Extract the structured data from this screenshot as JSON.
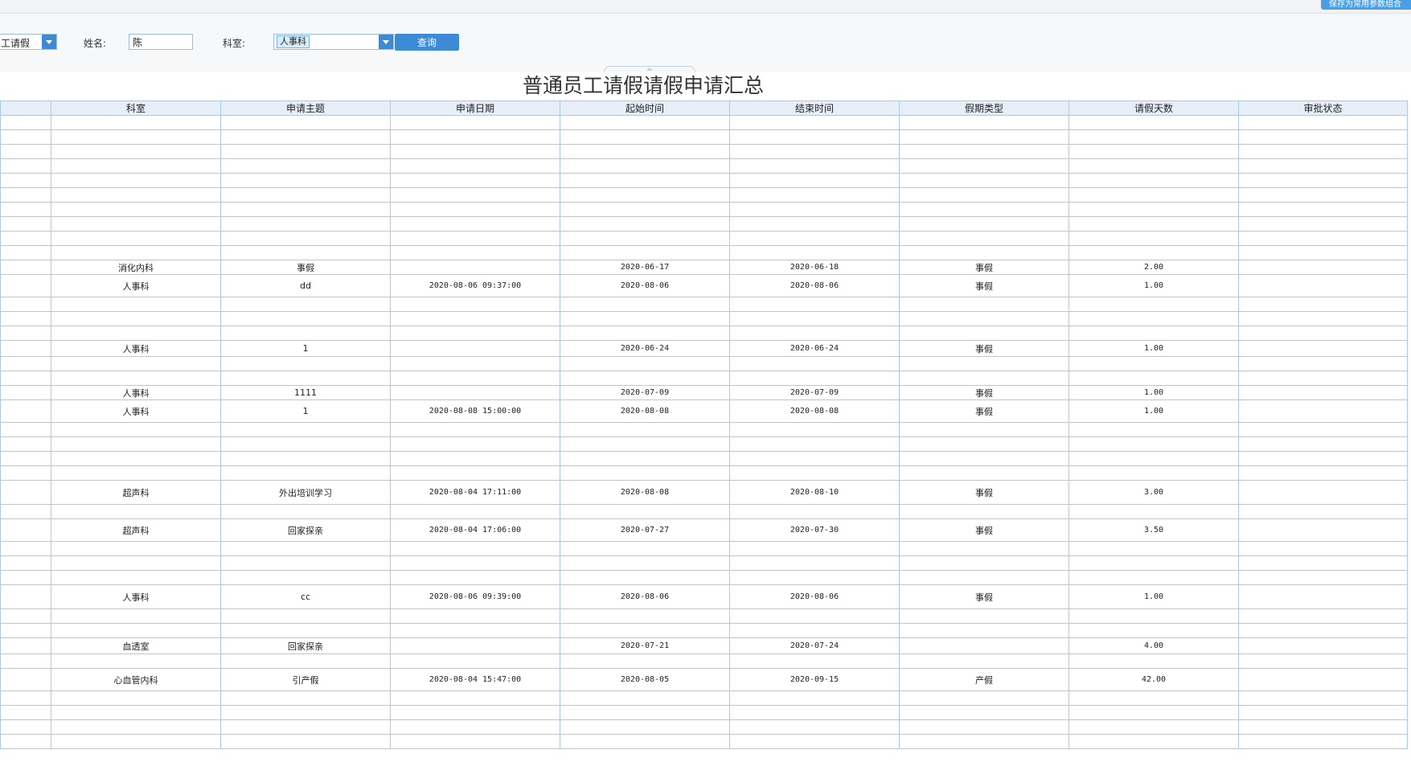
{
  "toolbar": {
    "save_label": "保存为常用参数组合"
  },
  "filters": {
    "type_value": "工请假",
    "name_label": "姓名:",
    "name_value": "陈",
    "dept_label": "科室:",
    "dept_tag": "人事科",
    "query_label": "查询"
  },
  "report": {
    "title": "普通员工请假请假申请汇总"
  },
  "table": {
    "headers": [
      "",
      "科室",
      "申请主题",
      "申请日期",
      "起始时间",
      "结束时间",
      "假期类型",
      "请假天数",
      "审批状态"
    ],
    "rows": [
      {
        "h": 18,
        "cells": [
          "",
          "",
          "",
          "",
          "",
          "",
          "",
          "",
          ""
        ]
      },
      {
        "h": 18,
        "cells": [
          "",
          "",
          "",
          "",
          "",
          "",
          "",
          "",
          ""
        ]
      },
      {
        "h": 18,
        "cells": [
          "",
          "",
          "",
          "",
          "",
          "",
          "",
          "",
          ""
        ]
      },
      {
        "h": 18,
        "cells": [
          "",
          "",
          "",
          "",
          "",
          "",
          "",
          "",
          ""
        ]
      },
      {
        "h": 18,
        "cells": [
          "",
          "",
          "",
          "",
          "",
          "",
          "",
          "",
          ""
        ]
      },
      {
        "h": 18,
        "cells": [
          "",
          "",
          "",
          "",
          "",
          "",
          "",
          "",
          ""
        ]
      },
      {
        "h": 18,
        "cells": [
          "",
          "",
          "",
          "",
          "",
          "",
          "",
          "",
          ""
        ]
      },
      {
        "h": 18,
        "cells": [
          "",
          "",
          "",
          "",
          "",
          "",
          "",
          "",
          ""
        ]
      },
      {
        "h": 18,
        "cells": [
          "",
          "",
          "",
          "",
          "",
          "",
          "",
          "",
          ""
        ]
      },
      {
        "h": 18,
        "cells": [
          "",
          "",
          "",
          "",
          "",
          "",
          "",
          "",
          ""
        ]
      },
      {
        "h": 18,
        "cells": [
          "",
          "消化内科",
          "事假",
          "",
          "2020-06-17",
          "2020-06-18",
          "事假",
          "2.00",
          ""
        ]
      },
      {
        "h": 28,
        "cells": [
          "",
          "人事科",
          "dd",
          "2020-08-06 09:37:00",
          "2020-08-06",
          "2020-08-06",
          "事假",
          "1.00",
          ""
        ]
      },
      {
        "h": 18,
        "cells": [
          "",
          "",
          "",
          "",
          "",
          "",
          "",
          "",
          ""
        ]
      },
      {
        "h": 18,
        "cells": [
          "",
          "",
          "",
          "",
          "",
          "",
          "",
          "",
          ""
        ]
      },
      {
        "h": 18,
        "cells": [
          "",
          "",
          "",
          "",
          "",
          "",
          "",
          "",
          ""
        ]
      },
      {
        "h": 20,
        "cells": [
          "",
          "人事科",
          "1",
          "",
          "2020-06-24",
          "2020-06-24",
          "事假",
          "1.00",
          ""
        ]
      },
      {
        "h": 18,
        "cells": [
          "",
          "",
          "",
          "",
          "",
          "",
          "",
          "",
          ""
        ]
      },
      {
        "h": 18,
        "cells": [
          "",
          "",
          "",
          "",
          "",
          "",
          "",
          "",
          ""
        ]
      },
      {
        "h": 18,
        "cells": [
          "",
          "人事科",
          "1111",
          "",
          "2020-07-09",
          "2020-07-09",
          "事假",
          "1.00",
          ""
        ]
      },
      {
        "h": 28,
        "cells": [
          "",
          "人事科",
          "1",
          "2020-08-08 15:00:00",
          "2020-08-08",
          "2020-08-08",
          "事假",
          "1.00",
          ""
        ]
      },
      {
        "h": 18,
        "cells": [
          "",
          "",
          "",
          "",
          "",
          "",
          "",
          "",
          ""
        ]
      },
      {
        "h": 18,
        "cells": [
          "",
          "",
          "",
          "",
          "",
          "",
          "",
          "",
          ""
        ]
      },
      {
        "h": 18,
        "cells": [
          "",
          "",
          "",
          "",
          "",
          "",
          "",
          "",
          ""
        ]
      },
      {
        "h": 18,
        "cells": [
          "",
          "",
          "",
          "",
          "",
          "",
          "",
          "",
          ""
        ]
      },
      {
        "h": 30,
        "cells": [
          "",
          "超声科",
          "外出培训学习",
          "2020-08-04 17:11:00",
          "2020-08-08",
          "2020-08-10",
          "事假",
          "3.00",
          ""
        ]
      },
      {
        "h": 18,
        "cells": [
          "",
          "",
          "",
          "",
          "",
          "",
          "",
          "",
          ""
        ]
      },
      {
        "h": 28,
        "cells": [
          "",
          "超声科",
          "回家探亲",
          "2020-08-04 17:06:00",
          "2020-07-27",
          "2020-07-30",
          "事假",
          "3.50",
          ""
        ]
      },
      {
        "h": 18,
        "cells": [
          "",
          "",
          "",
          "",
          "",
          "",
          "",
          "",
          ""
        ]
      },
      {
        "h": 18,
        "cells": [
          "",
          "",
          "",
          "",
          "",
          "",
          "",
          "",
          ""
        ]
      },
      {
        "h": 18,
        "cells": [
          "",
          "",
          "",
          "",
          "",
          "",
          "",
          "",
          ""
        ]
      },
      {
        "h": 30,
        "cells": [
          "",
          "人事科",
          "cc",
          "2020-08-06 09:39:00",
          "2020-08-06",
          "2020-08-06",
          "事假",
          "1.00",
          ""
        ]
      },
      {
        "h": 18,
        "cells": [
          "",
          "",
          "",
          "",
          "",
          "",
          "",
          "",
          ""
        ]
      },
      {
        "h": 18,
        "cells": [
          "",
          "",
          "",
          "",
          "",
          "",
          "",
          "",
          ""
        ]
      },
      {
        "h": 20,
        "cells": [
          "",
          "血透室",
          "回家探亲",
          "",
          "2020-07-21",
          "2020-07-24",
          "",
          "4.00",
          ""
        ]
      },
      {
        "h": 18,
        "cells": [
          "",
          "",
          "",
          "",
          "",
          "",
          "",
          "",
          ""
        ]
      },
      {
        "h": 28,
        "cells": [
          "",
          "心血管内科",
          "引产假",
          "2020-08-04 15:47:00",
          "2020-08-05",
          "2020-09-15",
          "产假",
          "42.00",
          ""
        ]
      },
      {
        "h": 18,
        "cells": [
          "",
          "",
          "",
          "",
          "",
          "",
          "",
          "",
          ""
        ]
      },
      {
        "h": 18,
        "cells": [
          "",
          "",
          "",
          "",
          "",
          "",
          "",
          "",
          ""
        ]
      },
      {
        "h": 18,
        "cells": [
          "",
          "",
          "",
          "",
          "",
          "",
          "",
          "",
          ""
        ]
      },
      {
        "h": 18,
        "cells": [
          "",
          "",
          "",
          "",
          "",
          "",
          "",
          "",
          ""
        ]
      }
    ]
  }
}
